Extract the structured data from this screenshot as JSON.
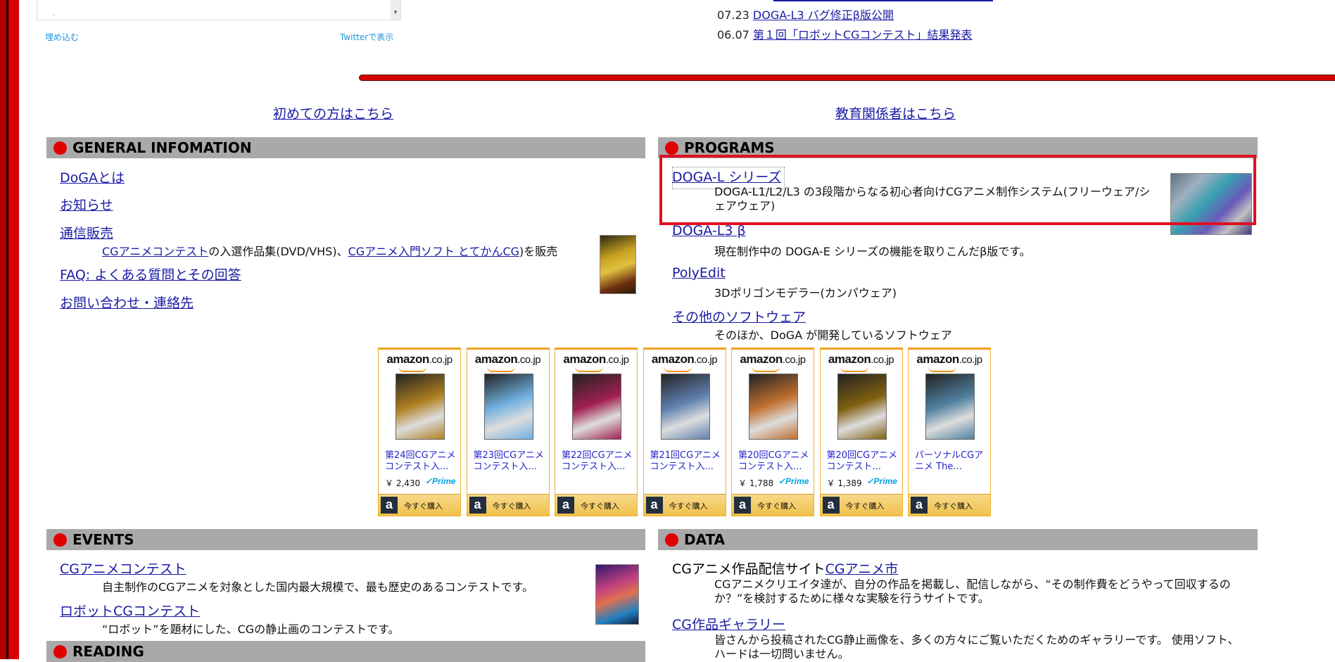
{
  "twitter": {
    "embed_label": "埋め込む",
    "view_label": "Twitterで表示",
    "scroll_arrow": "▾",
    "dot": "."
  },
  "news": [
    {
      "date": "07.23",
      "title": "DOGA-L3 バグ修正β版公開"
    },
    {
      "date": "06.07",
      "title": "第１回「ロボットCGコンテスト」結果発表"
    }
  ],
  "top_links": {
    "beginners": "初めての方はこちら",
    "educators": "教育関係者はこちら"
  },
  "general": {
    "heading": "GENERAL INFOMATION",
    "items": {
      "about": "DoGAとは",
      "notice": "お知らせ",
      "mail_order": "通信販売",
      "faq": "FAQ: よくある質問とその回答",
      "contact": "お問い合わせ・連絡先"
    },
    "mail_order_desc": {
      "link1": "CGアニメコンテスト",
      "text1": "の入選作品集(DVD/VHS)、",
      "link2": "CGアニメ入門ソフト とてかんCG",
      "text2": ")を販売"
    }
  },
  "programs": {
    "heading": "PROGRAMS",
    "items": [
      {
        "title": "DOGA-L シリーズ",
        "desc": "DOGA-L1/L2/L3 の3段階からなる初心者向けCGアニメ制作システム(フリーウェア/シェアウェア)"
      },
      {
        "title": "DOGA-L3 β",
        "desc": "現在制作中の DOGA-E シリーズの機能を取りこんだβ版です。"
      },
      {
        "title": "PolyEdit",
        "desc": "3Dポリゴンモデラー(カンパウェア)"
      },
      {
        "title": "その他のソフトウェア",
        "desc": "そのほか、DoGA が開発しているソフトウェア"
      }
    ]
  },
  "amazon": {
    "logo_main": "amazon",
    "logo_tld": ".co.jp",
    "buy_label": "今すぐ購入",
    "prime_label": "✓Prime",
    "products": [
      {
        "title": "第24回CGアニメコンテスト入...",
        "price": "￥ 2,430",
        "prime": true,
        "color": "#b08020"
      },
      {
        "title": "第23回CGアニメコンテスト入...",
        "price": "",
        "prime": false,
        "color": "#70b0e0"
      },
      {
        "title": "第22回CGアニメコンテスト入...",
        "price": "",
        "prime": false,
        "color": "#a02050"
      },
      {
        "title": "第21回CGアニメコンテスト入...",
        "price": "",
        "prime": false,
        "color": "#6080b0"
      },
      {
        "title": "第20回CGアニメコンテスト入...",
        "price": "￥ 1,788",
        "prime": true,
        "color": "#c07030"
      },
      {
        "title": "第20回CGアニメコンテスト...",
        "price": "￥ 1,389",
        "prime": true,
        "color": "#806010"
      },
      {
        "title": "パーソナルCGアニメ The...",
        "price": "",
        "prime": false,
        "color": "#5080a0"
      }
    ]
  },
  "events": {
    "heading": "EVENTS",
    "items": [
      {
        "title": "CGアニメコンテスト",
        "desc": "自主制作のCGアニメを対象とした国内最大規模で、最も歴史のあるコンテストです。"
      },
      {
        "title": "ロボットCGコンテスト",
        "desc": "“ロボット”を題材にした、CGの静止画のコンテストです。"
      }
    ]
  },
  "reading": {
    "heading": "READING"
  },
  "data": {
    "heading": "DATA",
    "item1_prefix": "CGアニメ作品配信サイト",
    "item1_link": "CGアニメ市",
    "item1_desc": "CGアニメクリエイタ達が、自分の作品を掲載し、配信しながら、“その制作費をどうやって回収するのか？”を検討するために様々な実験を行うサイトです。",
    "item2_link": "CG作品ギャラリー",
    "item2_desc": "皆さんから投稿されたCG静止画像を、多くの方々にご覧いただくためのギャラリーです。 使用ソフト、ハードは一切問いません。"
  }
}
